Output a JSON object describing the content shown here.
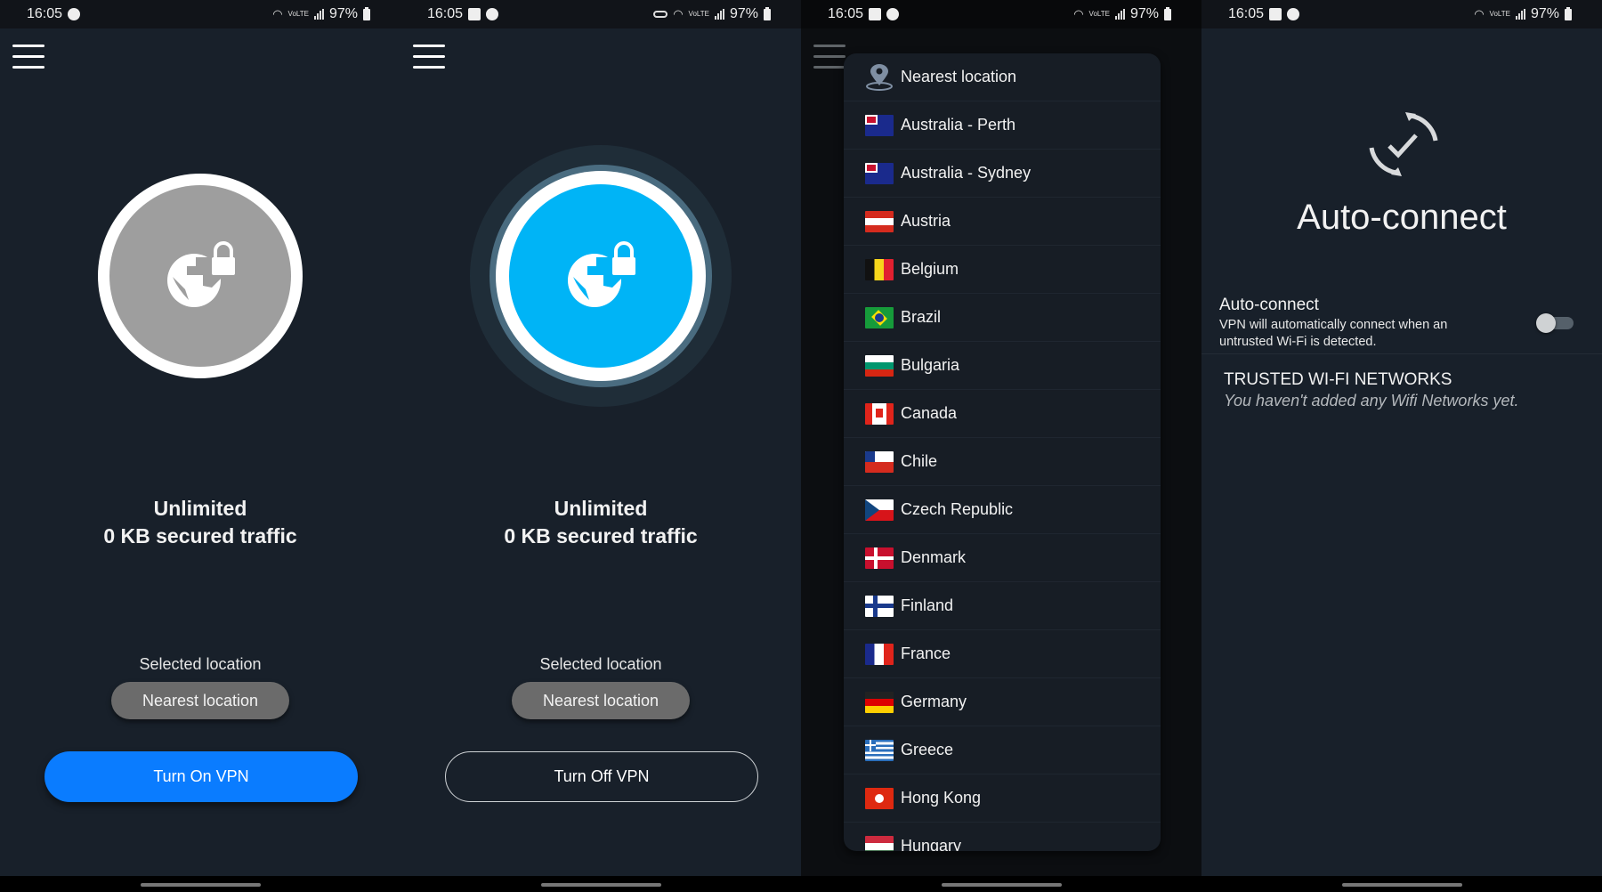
{
  "status_bar": {
    "time": "16:05",
    "battery": "97%",
    "network": "VoLTE"
  },
  "home_off": {
    "plan": "Unlimited",
    "traffic": "0 KB secured traffic",
    "selected_location_label": "Selected location",
    "selected_location": "Nearest location",
    "button": "Turn On VPN",
    "state": "disconnected",
    "accent_color": "#0a7cff",
    "circle_color": "#9e9e9e"
  },
  "home_on": {
    "plan": "Unlimited",
    "traffic": "0 KB secured traffic",
    "selected_location_label": "Selected location",
    "selected_location": "Nearest location",
    "button": "Turn Off VPN",
    "state": "connected",
    "circle_color": "#00b4f6"
  },
  "locations": {
    "items": [
      {
        "label": "Nearest location",
        "icon": "location-pin-icon"
      },
      {
        "label": "Australia - Perth",
        "flag": "au"
      },
      {
        "label": "Australia - Sydney",
        "flag": "au"
      },
      {
        "label": "Austria",
        "flag": "at"
      },
      {
        "label": "Belgium",
        "flag": "be"
      },
      {
        "label": "Brazil",
        "flag": "br"
      },
      {
        "label": "Bulgaria",
        "flag": "bg"
      },
      {
        "label": "Canada",
        "flag": "ca"
      },
      {
        "label": "Chile",
        "flag": "cl"
      },
      {
        "label": "Czech Republic",
        "flag": "cz"
      },
      {
        "label": "Denmark",
        "flag": "dk"
      },
      {
        "label": "Finland",
        "flag": "fi"
      },
      {
        "label": "France",
        "flag": "fr"
      },
      {
        "label": "Germany",
        "flag": "de"
      },
      {
        "label": "Greece",
        "flag": "gr"
      },
      {
        "label": "Hong Kong",
        "flag": "hk"
      },
      {
        "label": "Hungary",
        "flag": "hu"
      }
    ]
  },
  "auto_connect": {
    "title": "Auto-connect",
    "setting_label": "Auto-connect",
    "setting_desc": "VPN will automatically connect when an untrusted Wi-Fi is detected.",
    "enabled": false,
    "trusted_header": "TRUSTED WI-FI NETWORKS",
    "trusted_empty": "You haven't added any Wifi Networks yet."
  }
}
